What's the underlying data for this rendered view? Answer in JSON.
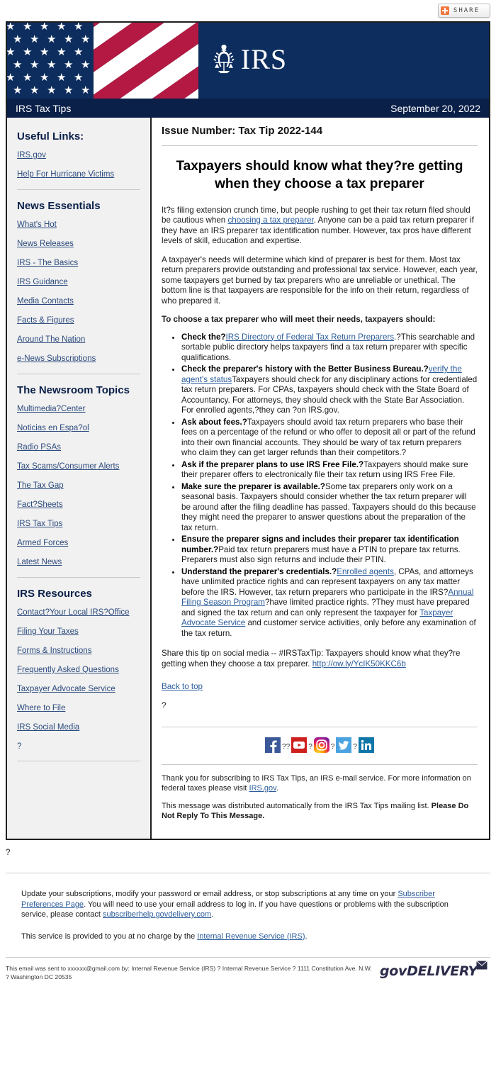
{
  "share": {
    "label": "SHARE",
    "icon": "plus-icon",
    "accent": "#f4783c"
  },
  "masthead": {
    "logo_text": "IRS",
    "seal_icon": "irs-eagle-scales-seal",
    "flag_icon": "us-flag-diagonal"
  },
  "titlebar": {
    "publication": "IRS Tax Tips",
    "date": "September 20, 2022",
    "bg": "#0a2049"
  },
  "sidebar": {
    "sections": [
      {
        "heading": "Useful Links:",
        "links": [
          "IRS.gov",
          "Help For Hurricane Victims"
        ]
      },
      {
        "heading": "News Essentials",
        "links": [
          "What's Hot",
          "News Releases",
          "IRS - The Basics",
          "IRS Guidance",
          "Media Contacts",
          "Facts & Figures",
          "Around The Nation",
          "e-News Subscriptions"
        ]
      },
      {
        "heading": "The Newsroom Topics",
        "links": [
          "Multimedia?Center",
          "Noticias en Espa?ol",
          "Radio PSAs",
          "Tax Scams/Consumer Alerts",
          "The Tax Gap",
          "Fact?Sheets",
          "IRS Tax Tips",
          "Armed Forces",
          "Latest News"
        ]
      },
      {
        "heading": "IRS Resources",
        "links": [
          "Contact?Your Local IRS?Office",
          "Filing Your Taxes",
          "Forms & Instructions",
          "Frequently Asked Questions",
          "Taxpayer Advocate Service",
          "Where to File",
          "IRS Social Media"
        ],
        "trailing_text": "?"
      }
    ]
  },
  "article": {
    "issue_number": "Issue Number: Tax Tip 2022-144",
    "headline": "Taxpayers should know what they?re getting when they choose a tax preparer",
    "paragraph_1_before": "It?s filing extension crunch time, but people rushing to get their tax return filed should be cautious when ",
    "paragraph_1_link": "choosing a tax preparer",
    "paragraph_1_after": ". Anyone can be a paid tax return preparer if they have an IRS preparer tax identification number. However, tax pros have different levels of skill, education and expertise.",
    "paragraph_2": "A taxpayer's needs will determine which kind of preparer is best for them. Most tax return preparers provide outstanding and professional tax service. However, each year, some taxpayers get burned by tax preparers who are unreliable or unethical. The bottom line is that taxpayers are responsible for the info on their return, regardless of who prepared it.",
    "lead_in": "To choose a tax preparer who will meet their needs, taxpayers should:",
    "bullets": [
      {
        "bold": "Check the?",
        "link_1": "IRS Directory of Federal Tax Return Preparers",
        "mid": ".?This searchable and sortable public directory helps taxpayers find a tax return preparer with specific qualifications."
      },
      {
        "bold": "Check the preparer's history with the Better Business Bureau.?",
        "text_1": "Taxpayers should check for any disciplinary actions for credentialed tax return preparers. For CPAs, taxpayers should check with the State Board of Accountancy. For attorneys, they should check with the State Bar Association. For enrolled agents,?they can ",
        "link_1": "verify the agent's status",
        "text_2": "?on IRS.gov."
      },
      {
        "bold": "Ask about fees.?",
        "text_1": "Taxpayers should avoid tax return preparers who base their fees on a percentage of the refund or who offer to deposit all or part of the refund into their own financial accounts. They should be wary of tax return preparers who claim they can get larger refunds than their competitors.?"
      },
      {
        "bold": "Ask if the preparer plans to use IRS Free File.?",
        "text_1": "Taxpayers should make sure their preparer offers to electronically file their tax return using IRS Free File."
      },
      {
        "bold": "Make sure the preparer is available.?",
        "text_1": "Some tax preparers only work on a seasonal basis. Taxpayers should consider whether the tax return preparer will be around after the filing deadline has passed. Taxpayers should do this because they might need the preparer to answer questions about the preparation of the tax return."
      },
      {
        "bold": "Ensure the preparer signs and includes their preparer tax identification number.?",
        "text_1": "Paid tax return preparers must have a PTIN to prepare tax returns. Preparers must also sign returns and include their PTIN."
      },
      {
        "bold": "Understand the preparer's credentials.?",
        "link_1": "Enrolled agents",
        "text_1": ", CPAs, and attorneys have unlimited practice rights and can represent taxpayers on any tax matter before the IRS. However, tax return preparers who participate in the IRS?",
        "link_2": "Annual Filing Season Program",
        "text_2": "?have limited practice rights. ?They must have prepared and signed the tax return and can only represent the taxpayer for ",
        "link_3": "Taxpayer Advocate Service",
        "text_3": " and customer service activities, only before any examination of the tax return."
      }
    ],
    "share_tip_text": "Share this tip on social media -- #IRSTaxTip: Taxpayers should know what they?re getting when they choose a tax preparer. ",
    "share_tip_link": "http://ow.ly/YcIK50KKC6b",
    "back_to_top": "Back to top",
    "lone_question_mark": "?"
  },
  "social": {
    "icons": [
      "facebook-icon",
      "youtube-icon",
      "instagram-icon",
      "twitter-icon",
      "linkedin-icon"
    ],
    "separators": [
      "??",
      "?",
      "?",
      "?"
    ]
  },
  "email_footer": {
    "thanks_before": "Thank you for subscribing to IRS Tax Tips, an IRS e-mail service. For more information on federal taxes please visit ",
    "thanks_link": "IRS.gov",
    "thanks_after": ".",
    "auto_text": "This message was distributed automatically from the IRS Tax Tips mailing list. ",
    "auto_bold": "Please Do Not Reply To This Message."
  },
  "outer_footer": {
    "stray_mark": "?",
    "update_before": "Update your subscriptions, modify your password or email address, or stop subscriptions at any time on your ",
    "update_link_1": "Subscriber Preferences Page",
    "update_mid": ". You will need to use your email address to log in. If you have questions or problems with the subscription service, please contact ",
    "update_link_2": "subscriberhelp.govdelivery.com",
    "update_after": ".",
    "service_before": "This service is provided to you at no charge by the ",
    "service_link": "Internal Revenue Service (IRS)",
    "service_after": ".",
    "sent_to": "This email was sent to xxxxxx@gmail.com by: Internal Revenue Service (IRS) ? Internal Revenue Service ? 1111 Constitution Ave. N.W. ? Washington DC 20535",
    "brand": "govDELIVERY",
    "brand_icon": "envelope-icon"
  }
}
